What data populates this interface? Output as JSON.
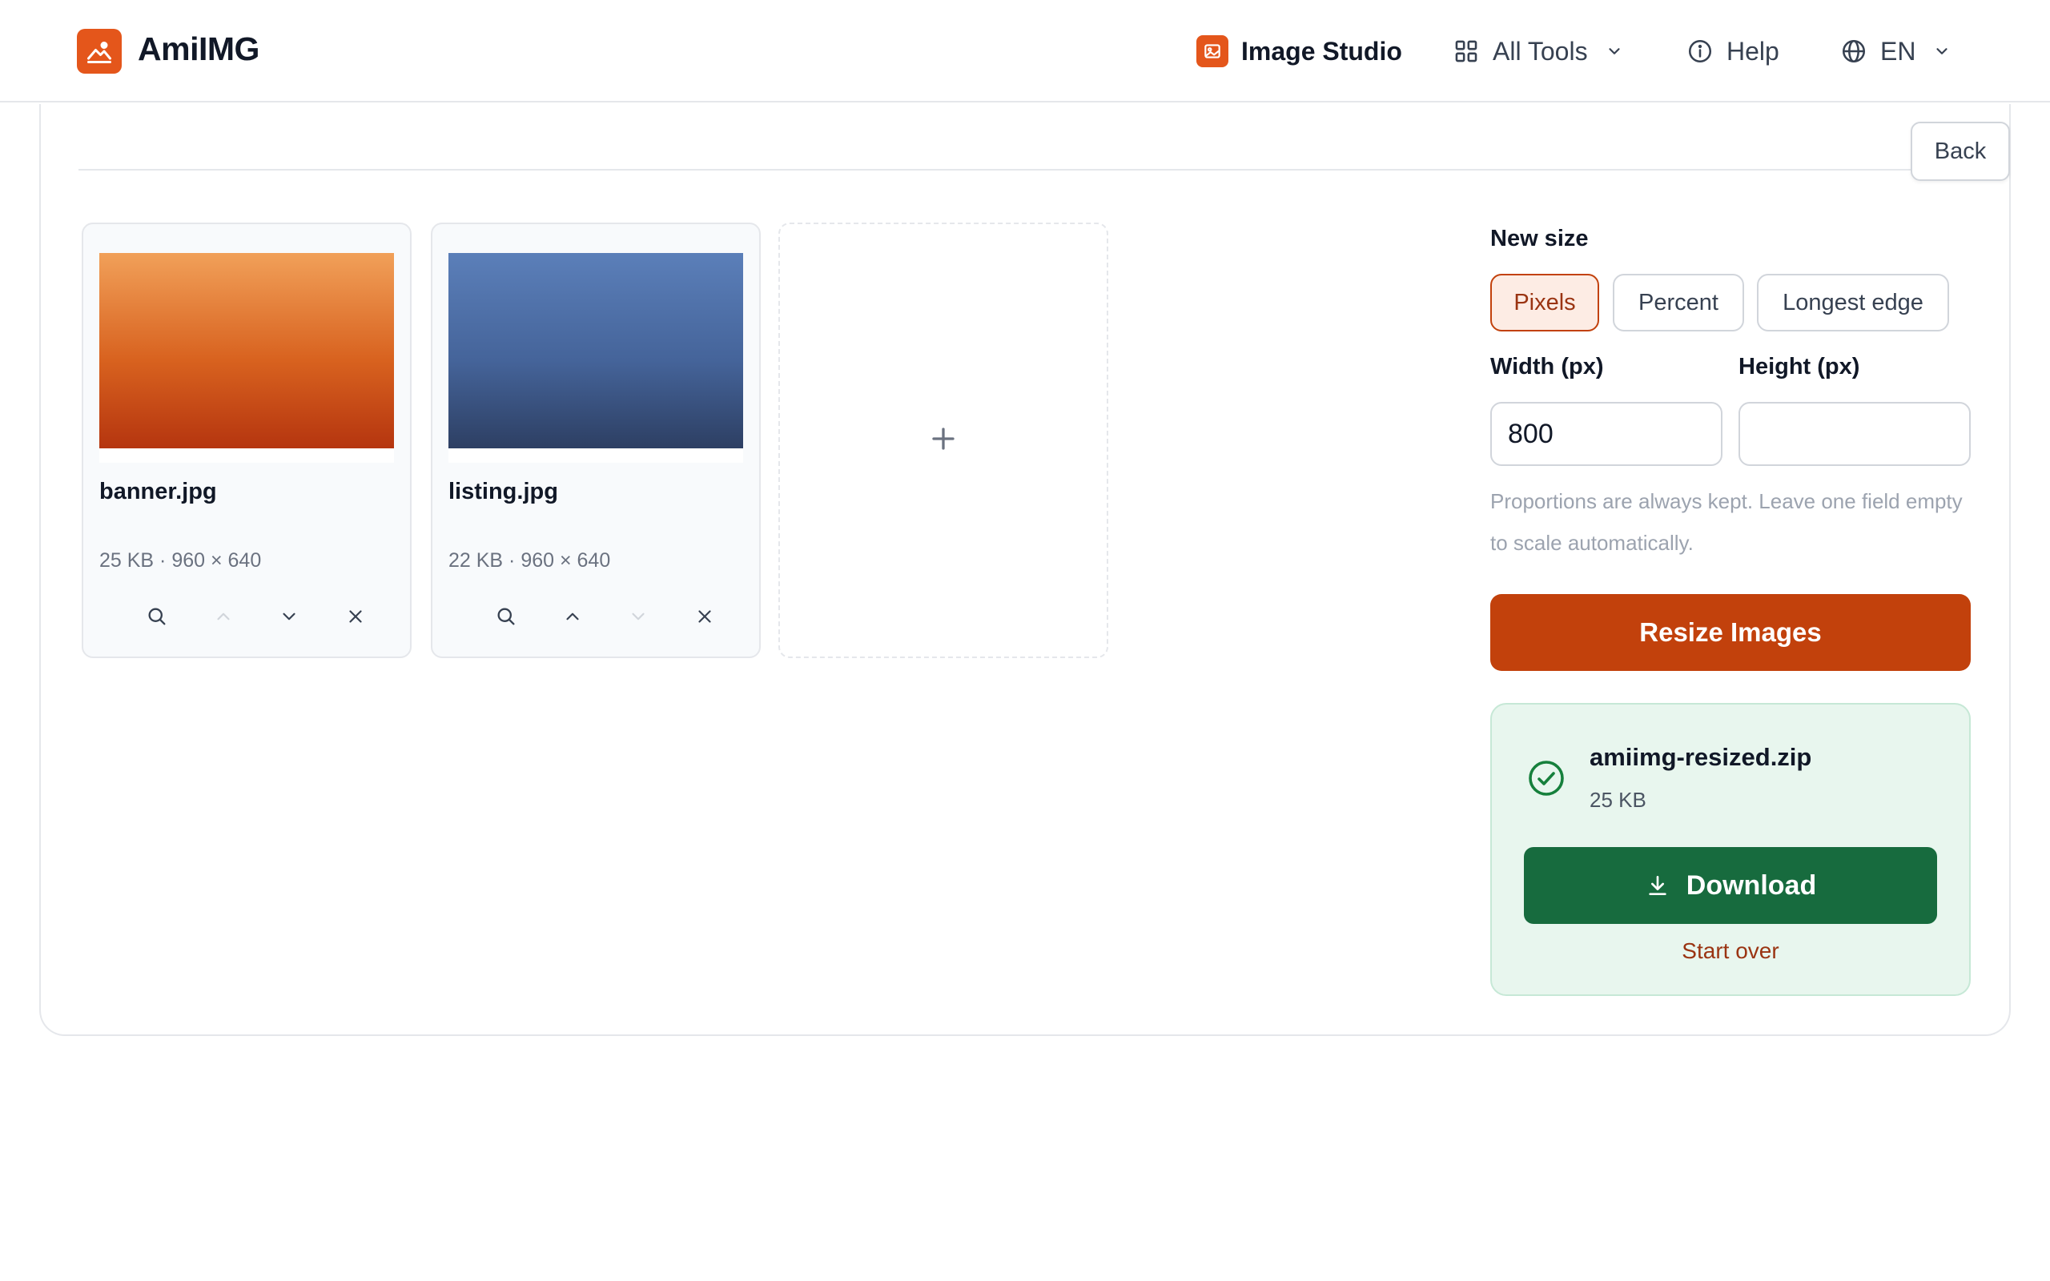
{
  "app": {
    "brand": "AmiIMG"
  },
  "nav": {
    "studio_label": "Image Studio",
    "tools_label": "All Tools",
    "help_label": "Help",
    "lang_label": "EN"
  },
  "toolbar": {
    "back_label": "Back"
  },
  "files": [
    {
      "name": "banner.jpg",
      "meta": "25 KB · 960 × 640",
      "thumb_color": "#d8621f"
    },
    {
      "name": "listing.jpg",
      "meta": "22 KB · 960 × 640",
      "thumb_color": "#45649a"
    }
  ],
  "settings": {
    "title": "New size",
    "modes": [
      "Pixels",
      "Percent",
      "Longest edge"
    ],
    "selected_mode": "Pixels",
    "width_label": "Width (px)",
    "height_label": "Height (px)",
    "width_value": "800",
    "height_value": "",
    "hint": "Proportions are always kept. Leave one field empty to scale automatically.",
    "resize_label": "Resize Images"
  },
  "result": {
    "file_name": "amiimg-resized.zip",
    "file_size": "25 KB",
    "download_label": "Download",
    "start_over_label": "Start over"
  },
  "colors": {
    "accent": "#c2410c",
    "brand": "#e4561b",
    "success": "#176b3e",
    "success_bg": "#e8f6ee"
  }
}
